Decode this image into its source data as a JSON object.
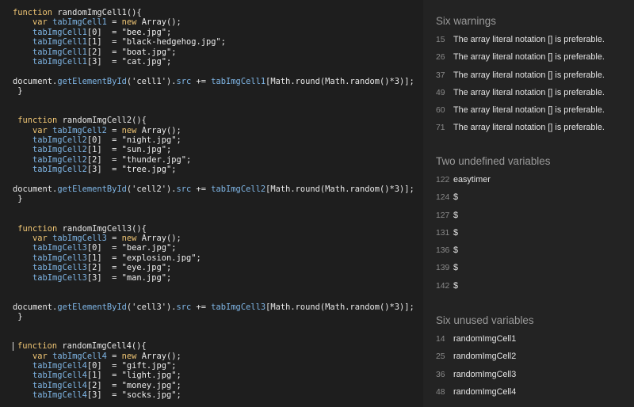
{
  "editor": {
    "lines": [
      [
        [
          "kw",
          "function "
        ],
        [
          "fn",
          "randomImgCell1(){"
        ]
      ],
      [
        [
          "op",
          "    "
        ],
        [
          "kw",
          "var "
        ],
        [
          "var",
          "tabImgCell1"
        ],
        [
          "op",
          " = "
        ],
        [
          "kw",
          "new "
        ],
        [
          "fn",
          "Array();"
        ]
      ],
      [
        [
          "op",
          "    "
        ],
        [
          "var",
          "tabImgCell1"
        ],
        [
          "op",
          "[0]  = "
        ],
        [
          "str",
          "\"bee.jpg\";"
        ]
      ],
      [
        [
          "op",
          "    "
        ],
        [
          "var",
          "tabImgCell1"
        ],
        [
          "op",
          "[1]  = "
        ],
        [
          "str",
          "\"black-hedgehog.jpg\";"
        ]
      ],
      [
        [
          "op",
          "    "
        ],
        [
          "var",
          "tabImgCell1"
        ],
        [
          "op",
          "[2]  = "
        ],
        [
          "str",
          "\"boat.jpg\";"
        ]
      ],
      [
        [
          "op",
          "    "
        ],
        [
          "var",
          "tabImgCell1"
        ],
        [
          "op",
          "[3]  = "
        ],
        [
          "str",
          "\"cat.jpg\";"
        ]
      ],
      [],
      [
        [
          "fn",
          "document."
        ],
        [
          "var",
          "getElementById"
        ],
        [
          "fn",
          "('cell1')."
        ],
        [
          "var",
          "src"
        ],
        [
          "op",
          " += "
        ],
        [
          "var",
          "tabImgCell1"
        ],
        [
          "fn",
          "[Math.round(Math.random()*3)];"
        ]
      ],
      [
        [
          "fn",
          " }"
        ]
      ],
      [],
      [],
      [
        [
          "kw",
          " function "
        ],
        [
          "fn",
          "randomImgCell2(){"
        ]
      ],
      [
        [
          "op",
          "    "
        ],
        [
          "kw",
          "var "
        ],
        [
          "var",
          "tabImgCell2"
        ],
        [
          "op",
          " = "
        ],
        [
          "kw",
          "new "
        ],
        [
          "fn",
          "Array();"
        ]
      ],
      [
        [
          "op",
          "    "
        ],
        [
          "var",
          "tabImgCell2"
        ],
        [
          "op",
          "[0]  = "
        ],
        [
          "str",
          "\"night.jpg\";"
        ]
      ],
      [
        [
          "op",
          "    "
        ],
        [
          "var",
          "tabImgCell2"
        ],
        [
          "op",
          "[1]  = "
        ],
        [
          "str",
          "\"sun.jpg\";"
        ]
      ],
      [
        [
          "op",
          "    "
        ],
        [
          "var",
          "tabImgCell2"
        ],
        [
          "op",
          "[2]  = "
        ],
        [
          "str",
          "\"thunder.jpg\";"
        ]
      ],
      [
        [
          "op",
          "    "
        ],
        [
          "var",
          "tabImgCell2"
        ],
        [
          "op",
          "[3]  = "
        ],
        [
          "str",
          "\"tree.jpg\";"
        ]
      ],
      [],
      [
        [
          "fn",
          "document."
        ],
        [
          "var",
          "getElementById"
        ],
        [
          "fn",
          "('cell2')."
        ],
        [
          "var",
          "src"
        ],
        [
          "op",
          " += "
        ],
        [
          "var",
          "tabImgCell2"
        ],
        [
          "fn",
          "[Math.round(Math.random()*3)];"
        ]
      ],
      [
        [
          "fn",
          " }"
        ]
      ],
      [],
      [],
      [
        [
          "kw",
          " function "
        ],
        [
          "fn",
          "randomImgCell3(){"
        ]
      ],
      [
        [
          "op",
          "    "
        ],
        [
          "kw",
          "var "
        ],
        [
          "var",
          "tabImgCell3"
        ],
        [
          "op",
          " = "
        ],
        [
          "kw",
          "new "
        ],
        [
          "fn",
          "Array();"
        ]
      ],
      [
        [
          "op",
          "    "
        ],
        [
          "var",
          "tabImgCell3"
        ],
        [
          "op",
          "[0]  = "
        ],
        [
          "str",
          "\"bear.jpg\";"
        ]
      ],
      [
        [
          "op",
          "    "
        ],
        [
          "var",
          "tabImgCell3"
        ],
        [
          "op",
          "[1]  = "
        ],
        [
          "str",
          "\"explosion.jpg\";"
        ]
      ],
      [
        [
          "op",
          "    "
        ],
        [
          "var",
          "tabImgCell3"
        ],
        [
          "op",
          "[2]  = "
        ],
        [
          "str",
          "\"eye.jpg\";"
        ]
      ],
      [
        [
          "op",
          "    "
        ],
        [
          "var",
          "tabImgCell3"
        ],
        [
          "op",
          "[3]  = "
        ],
        [
          "str",
          "\"man.jpg\";"
        ]
      ],
      [],
      [],
      [
        [
          "fn",
          "document."
        ],
        [
          "var",
          "getElementById"
        ],
        [
          "fn",
          "('cell3')."
        ],
        [
          "var",
          "src"
        ],
        [
          "op",
          " += "
        ],
        [
          "var",
          "tabImgCell3"
        ],
        [
          "fn",
          "[Math.round(Math.random()*3)];"
        ]
      ],
      [
        [
          "fn",
          " }"
        ]
      ],
      [],
      [],
      [
        [
          "cursor",
          ""
        ],
        [
          "kw",
          "function "
        ],
        [
          "fn",
          "randomImgCell4(){"
        ]
      ],
      [
        [
          "op",
          "    "
        ],
        [
          "kw",
          "var "
        ],
        [
          "var",
          "tabImgCell4"
        ],
        [
          "op",
          " = "
        ],
        [
          "kw",
          "new "
        ],
        [
          "fn",
          "Array();"
        ]
      ],
      [
        [
          "op",
          "    "
        ],
        [
          "var",
          "tabImgCell4"
        ],
        [
          "op",
          "[0]  = "
        ],
        [
          "str",
          "\"gift.jpg\";"
        ]
      ],
      [
        [
          "op",
          "    "
        ],
        [
          "var",
          "tabImgCell4"
        ],
        [
          "op",
          "[1]  = "
        ],
        [
          "str",
          "\"light.jpg\";"
        ]
      ],
      [
        [
          "op",
          "    "
        ],
        [
          "var",
          "tabImgCell4"
        ],
        [
          "op",
          "[2]  = "
        ],
        [
          "str",
          "\"money.jpg\";"
        ]
      ],
      [
        [
          "op",
          "    "
        ],
        [
          "var",
          "tabImgCell4"
        ],
        [
          "op",
          "[3]  = "
        ],
        [
          "str",
          "\"socks.jpg\";"
        ]
      ]
    ]
  },
  "lint": {
    "warnings": {
      "title": "Six warnings",
      "items": [
        {
          "line": "15",
          "text": "The array literal notation [] is preferable."
        },
        {
          "line": "26",
          "text": "The array literal notation [] is preferable."
        },
        {
          "line": "37",
          "text": "The array literal notation [] is preferable."
        },
        {
          "line": "49",
          "text": "The array literal notation [] is preferable."
        },
        {
          "line": "60",
          "text": "The array literal notation [] is preferable."
        },
        {
          "line": "71",
          "text": "The array literal notation [] is preferable."
        }
      ]
    },
    "undefined": {
      "title": "Two undefined variables",
      "items": [
        {
          "line": "122",
          "text": "easytimer"
        },
        {
          "line": "124",
          "text": "$"
        },
        {
          "line": "127",
          "text": "$"
        },
        {
          "line": "131",
          "text": "$"
        },
        {
          "line": "136",
          "text": "$"
        },
        {
          "line": "139",
          "text": "$"
        },
        {
          "line": "142",
          "text": "$"
        }
      ]
    },
    "unused": {
      "title": "Six unused variables",
      "items": [
        {
          "line": "14",
          "text": "randomImgCell1"
        },
        {
          "line": "25",
          "text": "randomImgCell2"
        },
        {
          "line": "36",
          "text": "randomImgCell3"
        },
        {
          "line": "48",
          "text": "randomImgCell4"
        }
      ]
    }
  }
}
